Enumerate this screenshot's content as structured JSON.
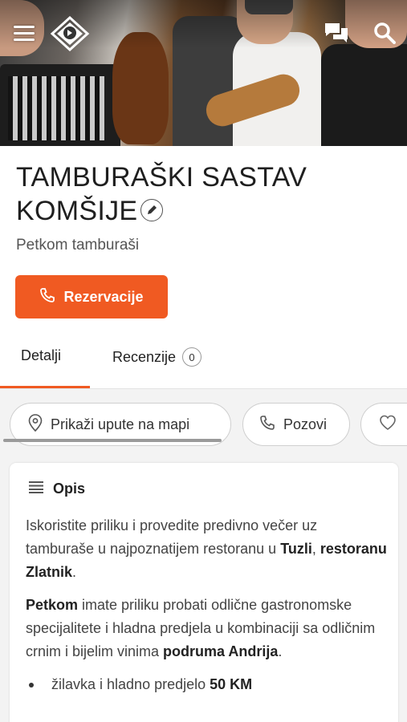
{
  "header": {
    "menu_icon": "hamburger-menu-icon",
    "logo_icon": "diamond-logo-icon",
    "chat_icon": "chat-bubbles-icon",
    "search_icon": "search-icon"
  },
  "listing": {
    "title_line1": "TAMBURAŠKI SASTAV",
    "title_line2": "KOMŠIJE",
    "subtitle": "Petkom tamburaši",
    "reserve_label": "Rezervacije"
  },
  "tabs": {
    "details_label": "Detalji",
    "reviews_label": "Recenzije",
    "reviews_count": "0"
  },
  "actions": {
    "map_label": "Prikaži upute na mapi",
    "call_label": "Pozovi"
  },
  "description": {
    "heading": "Opis",
    "p1_a": "Iskoristite priliku i provedite predivno večer uz tamburaše u najpoznatijem restoranu u ",
    "p1_b": "Tuzli",
    "p1_c": ", ",
    "p1_d": "restoranu Zlatnik",
    "p1_e": ".",
    "p2_a": "Petkom",
    "p2_b": " imate priliku probati odlične gastronomske specijalitete i hladna predjela u kombinaciji sa odličnim crnim i bijelim vinima ",
    "p2_c": "podruma Andrija",
    "p2_d": ".",
    "bullet1_a": "žilavka i hladno predjelo ",
    "bullet1_b": "50 KM"
  },
  "colors": {
    "accent": "#f05a22"
  }
}
